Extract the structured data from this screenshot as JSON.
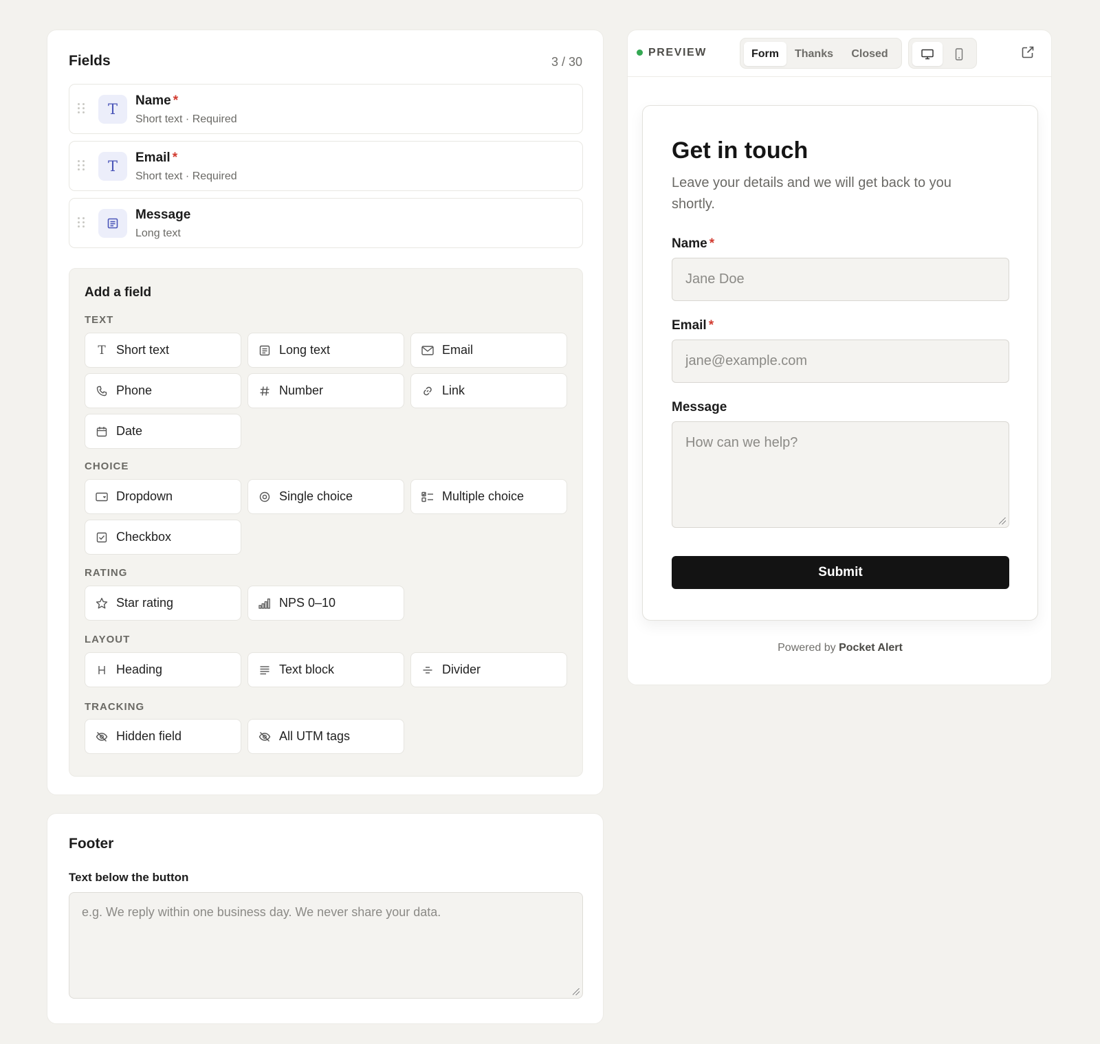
{
  "fields_panel": {
    "title": "Fields",
    "count": "3 / 30",
    "fields": [
      {
        "name": "Name",
        "required": "*",
        "sub": "Short text · Required",
        "icon": "text-type-icon"
      },
      {
        "name": "Email",
        "required": "*",
        "sub": "Short text · Required",
        "icon": "text-type-icon"
      },
      {
        "name": "Message",
        "required": "",
        "sub": "Long text",
        "icon": "long-text-icon"
      }
    ]
  },
  "add_field": {
    "title": "Add a field",
    "groups": {
      "text": {
        "label": "TEXT",
        "options": [
          {
            "label": "Short text",
            "icon": "text-type-icon"
          },
          {
            "label": "Long text",
            "icon": "long-text-icon"
          },
          {
            "label": "Email",
            "icon": "mail-icon"
          },
          {
            "label": "Phone",
            "icon": "phone-icon"
          },
          {
            "label": "Number",
            "icon": "hash-icon"
          },
          {
            "label": "Link",
            "icon": "link-icon"
          },
          {
            "label": "Date",
            "icon": "calendar-icon"
          }
        ]
      },
      "choice": {
        "label": "CHOICE",
        "options": [
          {
            "label": "Dropdown",
            "icon": "dropdown-icon"
          },
          {
            "label": "Single choice",
            "icon": "radio-icon"
          },
          {
            "label": "Multiple choice",
            "icon": "multi-choice-icon"
          },
          {
            "label": "Checkbox",
            "icon": "checkbox-icon"
          }
        ]
      },
      "rating": {
        "label": "RATING",
        "options": [
          {
            "label": "Star rating",
            "icon": "star-icon"
          },
          {
            "label": "NPS 0–10",
            "icon": "signal-bars-icon"
          }
        ]
      },
      "layout": {
        "label": "LAYOUT",
        "options": [
          {
            "label": "Heading",
            "icon": "heading-icon"
          },
          {
            "label": "Text block",
            "icon": "text-block-icon"
          },
          {
            "label": "Divider",
            "icon": "divider-icon"
          }
        ]
      },
      "tracking": {
        "label": "TRACKING",
        "options": [
          {
            "label": "Hidden field",
            "icon": "eye-off-icon"
          },
          {
            "label": "All UTM tags",
            "icon": "eye-off-icon"
          }
        ]
      }
    }
  },
  "footer": {
    "title": "Footer",
    "label": "Text below the button",
    "placeholder": "e.g. We reply within one business day. We never share your data."
  },
  "preview": {
    "label": "PREVIEW",
    "tabs": [
      "Form",
      "Thanks",
      "Closed"
    ],
    "active_tab": "Form",
    "devices": [
      "desktop-icon",
      "mobile-icon"
    ],
    "active_device": "desktop-icon",
    "form": {
      "title": "Get in touch",
      "description": "Leave your details and we will get back to you shortly.",
      "name_label": "Name",
      "name_placeholder": "Jane Doe",
      "email_label": "Email",
      "email_placeholder": "jane@example.com",
      "message_label": "Message",
      "message_placeholder": "How can we help?",
      "required_mark": "*",
      "submit_label": "Submit"
    },
    "powered_prefix": "Powered by",
    "powered_brand": "Pocket Alert"
  },
  "colors": {
    "page_bg": "#f3f2ee",
    "accent_icon": "#4a55b8",
    "required": "#d23b30",
    "submit_bg": "#131313",
    "status_dot": "#34a853"
  }
}
